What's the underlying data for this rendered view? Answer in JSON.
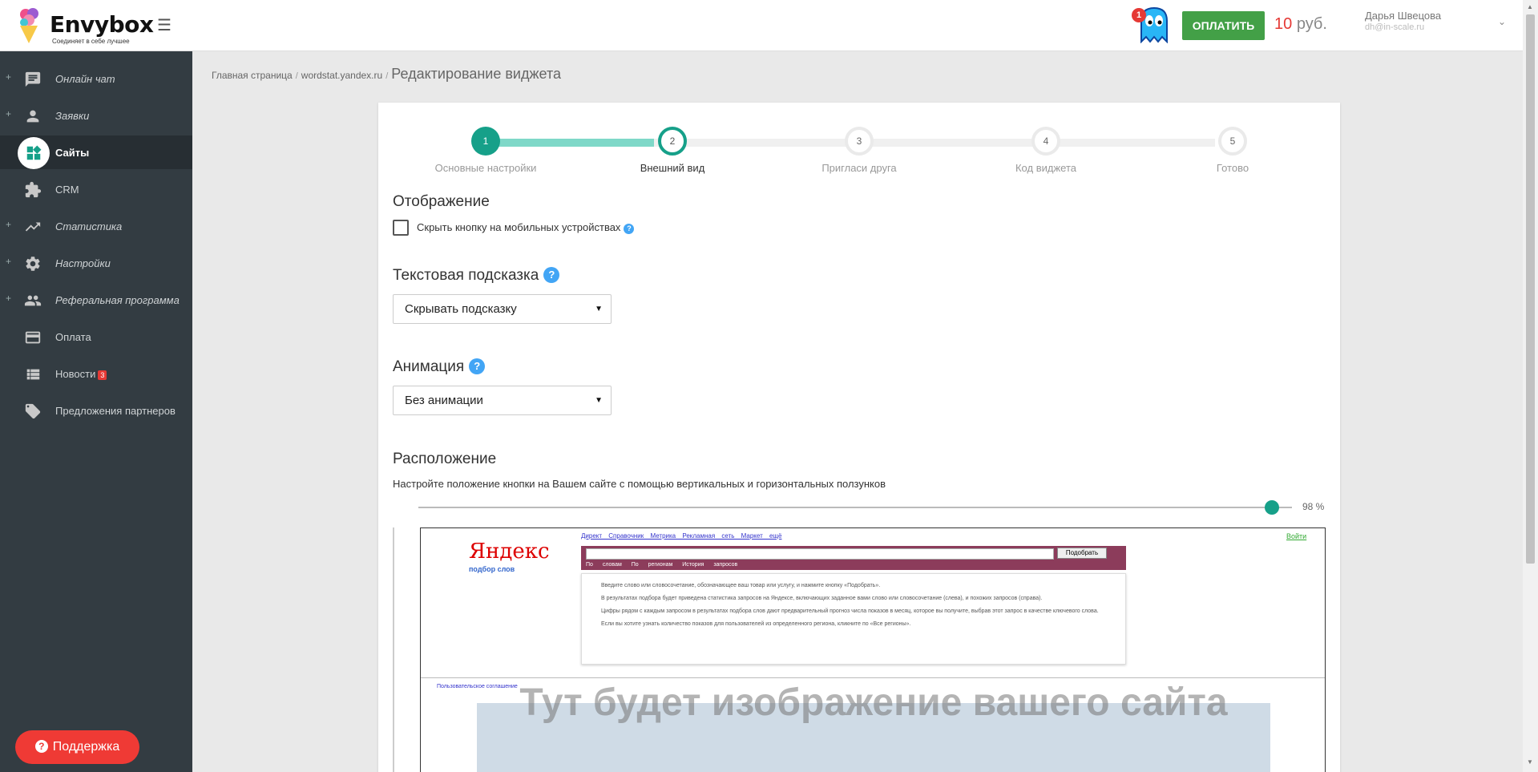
{
  "header": {
    "logo_title": "Envybox",
    "logo_subtitle": "Соединяет в себе лучшее",
    "notification_count": "1",
    "pay_button": "ОПЛАТИТЬ",
    "balance_amount": "10",
    "balance_currency": "руб.",
    "user_name": "Дарья Швецова",
    "user_email": "dh@in-scale.ru"
  },
  "sidebar": {
    "items": [
      {
        "label": "Онлайн чат",
        "icon": "chat-icon"
      },
      {
        "label": "Заявки",
        "icon": "person-icon"
      },
      {
        "label": "Сайты",
        "icon": "dashboard-icon",
        "active": true
      },
      {
        "label": "CRM",
        "icon": "puzzle-icon"
      },
      {
        "label": "Статистика",
        "icon": "trending-icon"
      },
      {
        "label": "Настройки",
        "icon": "gear-icon"
      },
      {
        "label": "Реферальная программа",
        "icon": "people-icon"
      },
      {
        "label": "Оплата",
        "icon": "card-icon"
      },
      {
        "label": "Новости",
        "icon": "list-icon",
        "badge": "3"
      },
      {
        "label": "Предложения партнеров",
        "icon": "tag-icon"
      }
    ],
    "support_button": "Поддержка"
  },
  "breadcrumb": {
    "home": "Главная страница",
    "site": "wordstat.yandex.ru",
    "current": "Редактирование виджета"
  },
  "stepper": {
    "steps": [
      {
        "num": "1",
        "label": "Основные настройки",
        "state": "done"
      },
      {
        "num": "2",
        "label": "Внешний вид",
        "state": "current"
      },
      {
        "num": "3",
        "label": "Пригласи друга",
        "state": "todo"
      },
      {
        "num": "4",
        "label": "Код виджета",
        "state": "todo"
      },
      {
        "num": "5",
        "label": "Готово",
        "state": "todo"
      }
    ]
  },
  "display": {
    "title": "Отображение",
    "hide_mobile_label": "Скрыть кнопку на мобильных устройствах",
    "hide_mobile_checked": false
  },
  "hint": {
    "title": "Текстовая подсказка",
    "selected": "Скрывать подсказку"
  },
  "animation": {
    "title": "Анимация",
    "selected": "Без анимации"
  },
  "position": {
    "title": "Расположение",
    "description": "Настройте положение кнопки на Вашем сайте с помощью вертикальных и горизонтальных ползунков",
    "horizontal_value": 98,
    "horizontal_value_label": "98 %"
  },
  "preview": {
    "placeholder_text": "Тут будет изображение вашего сайта",
    "site": {
      "logo": "Яндекс",
      "logo_sub": "подбор слов",
      "links": "Директ Справочник Метрика Рекламная сеть Маркет ещё",
      "login": "Войти",
      "search_button": "Подобрать",
      "radios": "По словам По регионам История запросов",
      "paragraph1": "Введите слово или словосочетание, обозначающее ваш товар или услугу, и нажмите кнопку «Подобрать».",
      "paragraph2": "В результатах подбора будет приведена статистика запросов на Яндексе, включающих заданное вами слово или словосочетание (слева), и похожих запросов (справа).",
      "paragraph3": "Цифры рядом с каждым запросом в результатах подбора слов дают предварительный прогноз числа показов в месяц, которое вы получите, выбрав этот запрос в качестве ключевого слова.",
      "paragraph4": "Если вы хотите узнать количество показов для пользователей из определенного региона, кликните по «Все регионы».",
      "footer": "Пользовательское соглашение"
    }
  },
  "colors": {
    "accent": "#16a089",
    "sidebar_bg": "#333c42",
    "pay_green": "#43a047",
    "alert_red": "#e53935"
  }
}
